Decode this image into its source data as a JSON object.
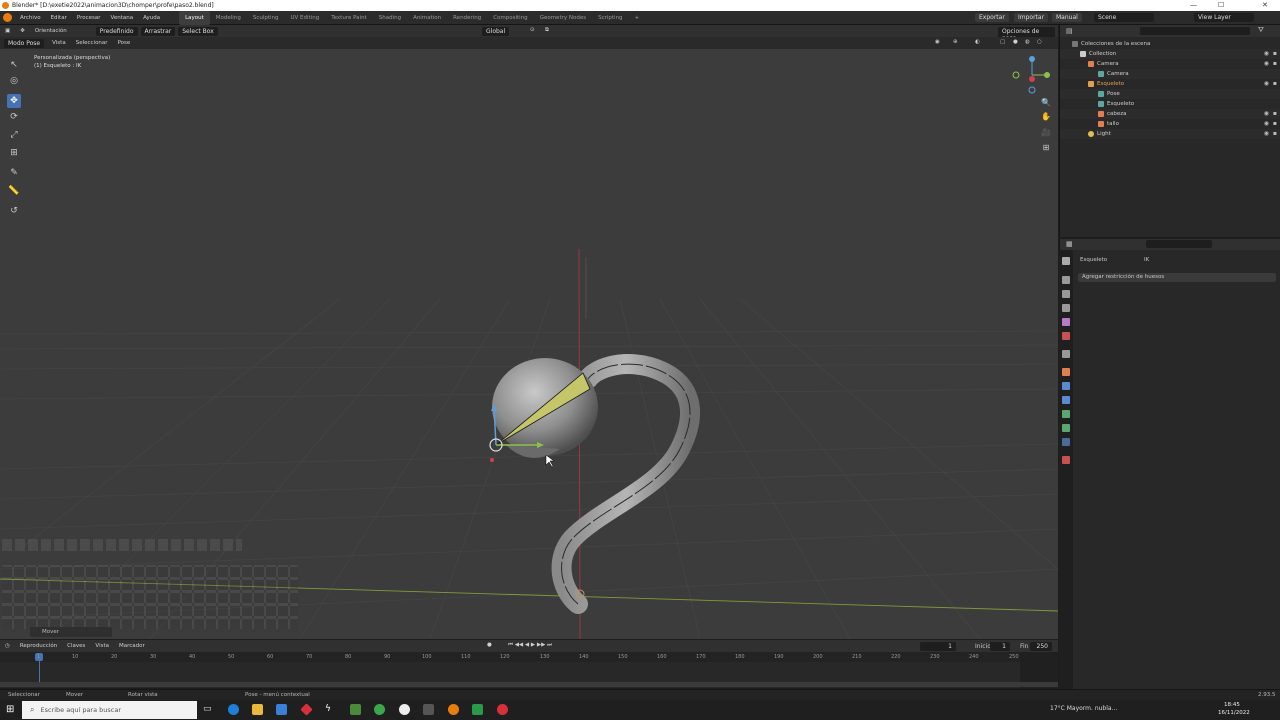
{
  "window": {
    "title": "Blender* [D:\\exetie2022\\animacion3D\\chomper\\profe\\paso2.blend]",
    "min": "—",
    "max": "☐",
    "close": "✕"
  },
  "menu": [
    "Archivo",
    "Editar",
    "Procesar",
    "Ventana",
    "Ayuda"
  ],
  "workspaces": [
    "Layout",
    "Modeling",
    "Sculpting",
    "UV Editing",
    "Texture Paint",
    "Shading",
    "Animation",
    "Rendering",
    "Compositing",
    "Geometry Nodes",
    "Scripting"
  ],
  "workspace_add": "+",
  "topright": {
    "export": "Exportar",
    "import": "Importar",
    "manual": "Manual",
    "scene": "Scene",
    "view_layer": "View Layer"
  },
  "viewport_header": {
    "orientation_label": "Orientación",
    "default": "Predefinido",
    "drag_label": "Arrastrar",
    "select_box": "Select Box",
    "transform": "Global",
    "pose_options": "Opciones de pose"
  },
  "viewport_header2": {
    "mode": "Modo Pose",
    "view": "Vista",
    "select": "Seleccionar",
    "pose": "Pose"
  },
  "overlay_text": {
    "line1": "Personalizada (perspectiva)",
    "line2": "(1) Esqueleto : IK"
  },
  "tools": [
    "↖",
    "◎",
    "✥",
    "⟳",
    "⤢",
    "⊞",
    "✎",
    "📏",
    "↺"
  ],
  "nav_icons": [
    "🔍",
    "✋",
    "🎥",
    "⊞"
  ],
  "outliner": {
    "header_search": "",
    "rows": [
      {
        "label": "Colecciones de la escena",
        "indent": 0,
        "color": "#8a8a8a"
      },
      {
        "label": "Collection",
        "indent": 1,
        "color": "#cccccc"
      },
      {
        "label": "Camera",
        "indent": 2,
        "color": "#e08050"
      },
      {
        "label": "Camera",
        "indent": 3,
        "color": "#5aa8a0"
      },
      {
        "label": "Esqueleto",
        "indent": 2,
        "color": "#e0a050"
      },
      {
        "label": "Pose",
        "indent": 3,
        "color": "#5aa8a0"
      },
      {
        "label": "Esqueleto",
        "indent": 3,
        "color": "#5aa8a0"
      },
      {
        "label": "cabeza",
        "indent": 3,
        "color": "#e08050"
      },
      {
        "label": "tallo",
        "indent": 3,
        "color": "#e08050"
      },
      {
        "label": "Light",
        "indent": 2,
        "color": "#e0c050"
      }
    ]
  },
  "properties": {
    "object_name": "Esqueleto",
    "bone_name": "IK",
    "add_constraint": "Agregar restricción de huesos"
  },
  "timeline_header": {
    "playback": "Reproducción",
    "keys": "Claves",
    "view": "Vista",
    "marker": "Marcador",
    "current": "1",
    "start_label": "Inicio",
    "start": "1",
    "end_label": "Fin",
    "end": "250"
  },
  "timeline_frames": [
    "1",
    "10",
    "20",
    "30",
    "40",
    "50",
    "60",
    "70",
    "80",
    "90",
    "100",
    "110",
    "120",
    "130",
    "140",
    "150",
    "160",
    "170",
    "180",
    "190",
    "200",
    "210",
    "220",
    "230",
    "240",
    "250"
  ],
  "statusbar": {
    "select": "Seleccionar",
    "move": "Mover",
    "rotate": "Rotar vista",
    "context": "Pose - menú contextual",
    "version": "2.93.5"
  },
  "move_label": "Mover",
  "taskbar": {
    "search_placeholder": "Escribe aquí para buscar",
    "weather": "17°C  Mayorm. nubla...",
    "time": "18:45",
    "date": "16/11/2022"
  }
}
